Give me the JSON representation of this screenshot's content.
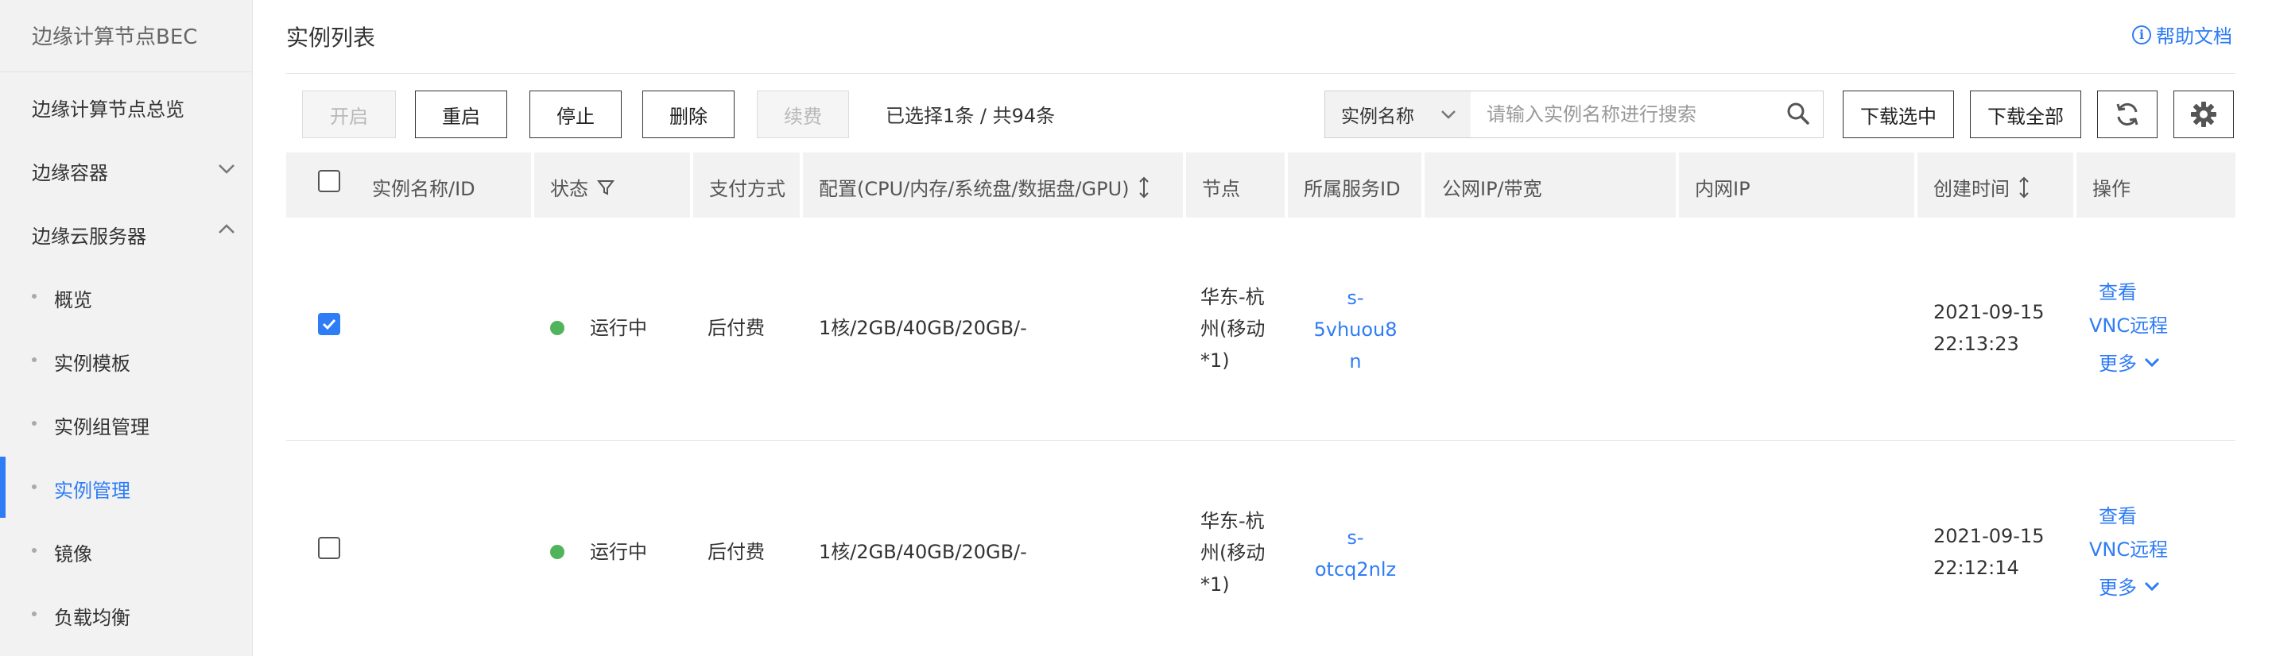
{
  "sidebar": {
    "title": "边缘计算节点BEC",
    "items": [
      {
        "label": "边缘计算节点总览"
      },
      {
        "label": "边缘容器",
        "expanded": false
      },
      {
        "label": "边缘云服务器",
        "expanded": true
      }
    ],
    "subitems": [
      {
        "label": "概览",
        "active": false
      },
      {
        "label": "实例模板",
        "active": false
      },
      {
        "label": "实例组管理",
        "active": false
      },
      {
        "label": "实例管理",
        "active": true
      },
      {
        "label": "镜像",
        "active": false
      },
      {
        "label": "负载均衡",
        "active": false
      }
    ]
  },
  "header": {
    "title": "实例列表",
    "help_label": "帮助文档",
    "help_icon": "info-icon"
  },
  "toolbar": {
    "start_label": "开启",
    "restart_label": "重启",
    "stop_label": "停止",
    "delete_label": "删除",
    "renew_label": "续费",
    "selection_info": "已选择1条 / 共94条",
    "search_field_label": "实例名称",
    "search_placeholder": "请输入实例名称进行搜索",
    "download_selected_label": "下载选中",
    "download_all_label": "下载全部",
    "refresh_icon": "refresh-icon",
    "settings_icon": "gear-icon"
  },
  "table": {
    "columns": [
      "实例名称/ID",
      "状态",
      "支付方式",
      "配置(CPU/内存/系统盘/数据盘/GPU)",
      "节点",
      "所属服务ID",
      "公网IP/带宽",
      "内网IP",
      "创建时间",
      "操作"
    ],
    "rows": [
      {
        "checked": true,
        "status": "运行中",
        "payment": "后付费",
        "config": "1核/2GB/40GB/20GB/-",
        "node_lines": [
          "华东-杭",
          "州(移动",
          "*1)"
        ],
        "service_id_lines": [
          "s-",
          "5vhuou8",
          "n"
        ],
        "created_lines": [
          "2021-09-15",
          "22:13:23"
        ],
        "ops": {
          "view": "查看",
          "vnc": "VNC远程",
          "more": "更多"
        }
      },
      {
        "checked": false,
        "status": "运行中",
        "payment": "后付费",
        "config": "1核/2GB/40GB/20GB/-",
        "node_lines": [
          "华东-杭",
          "州(移动",
          "*1)"
        ],
        "service_id_lines": [
          "s-",
          "otcq2nlz"
        ],
        "created_lines": [
          "2021-09-15",
          "22:12:14"
        ],
        "ops": {
          "view": "查看",
          "vnc": "VNC远程",
          "more": "更多"
        }
      }
    ]
  },
  "colors": {
    "accent": "#2e7cf6",
    "status_running": "#52b35d"
  }
}
